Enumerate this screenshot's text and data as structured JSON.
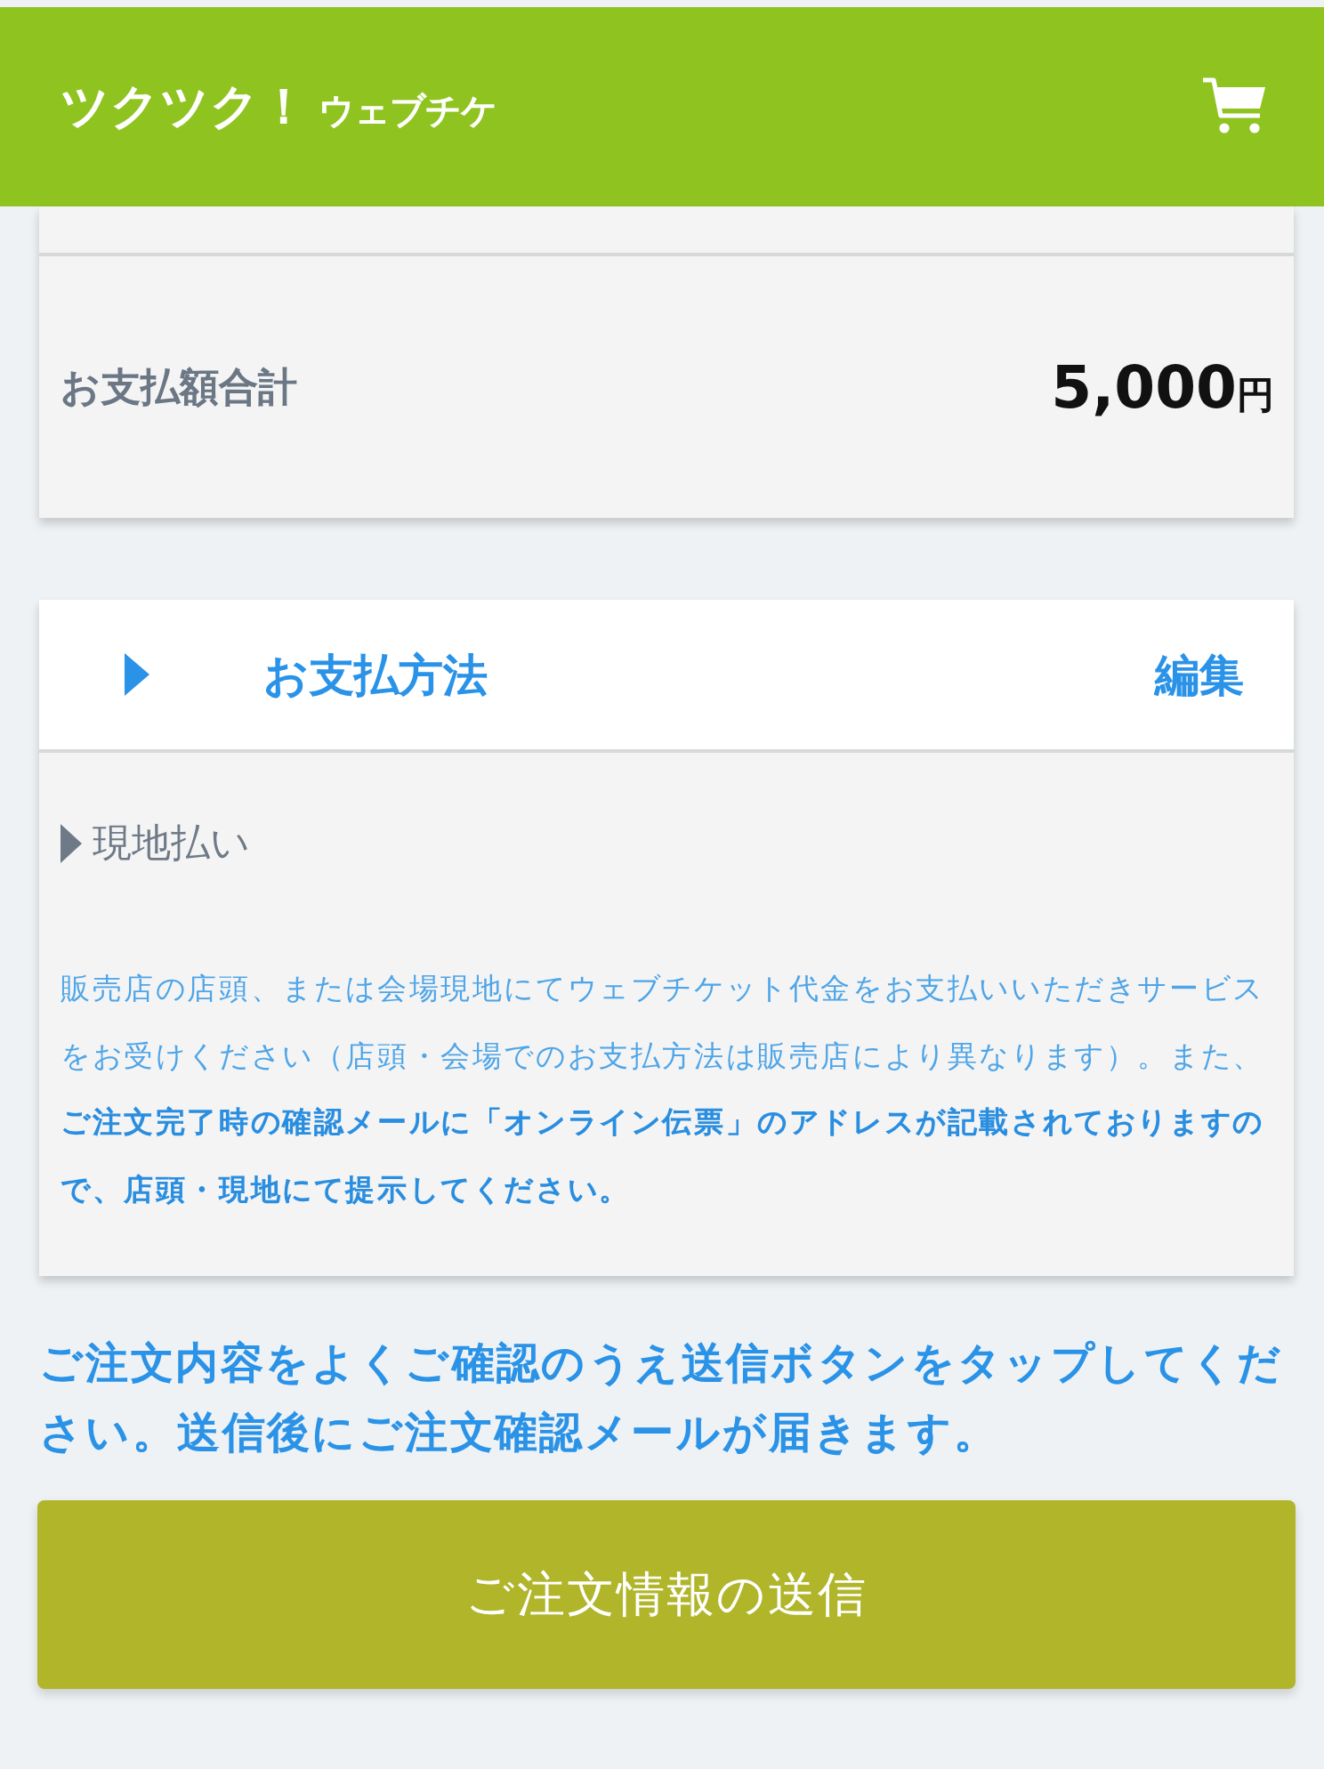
{
  "header": {
    "title": "ツクツク！",
    "subtitle": "ウェブチケ"
  },
  "total": {
    "label": "お支払額合計",
    "amount": "5,000",
    "unit": "円"
  },
  "payment": {
    "title": "お支払方法",
    "edit": "編集",
    "method": "現地払い",
    "description": "販売店の店頭、または会場現地にてウェブチケット代金をお支払いいただきサービスをお受けください（店頭・会場でのお支払方法は販売店により異なります）。また、**ご注文完了時の確認メールに「オンライン伝票」のアドレスが記載されておりますので、店頭・現地にて提示してください。**"
  },
  "notice": "ご注文内容をよくご確認のうえ送信ボタンをタップしてください。送信後にご注文確認メールが届きます。",
  "submit_button": "ご注文情報の送信"
}
